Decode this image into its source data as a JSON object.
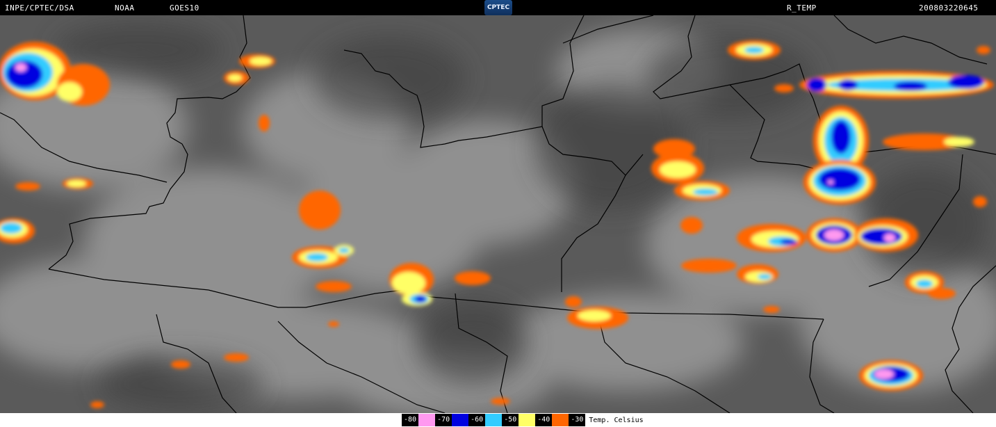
{
  "header": {
    "source": "INPE/CPTEC/DSA",
    "agency": "NOAA",
    "satellite": "GOES10",
    "logo_text": "CPTEC",
    "product": "R_TEMP",
    "timestamp": "200803220645"
  },
  "legend": {
    "entries": [
      {
        "label": "-80",
        "color": "#ff99f0"
      },
      {
        "label": "-70",
        "color": "#0000e0"
      },
      {
        "label": "-60",
        "color": "#33ccff"
      },
      {
        "label": "-50",
        "color": "#ffff66"
      },
      {
        "label": "-40",
        "color": "#ff6600"
      },
      {
        "label": "-30",
        "color": ""
      }
    ],
    "units": "Temp. Celsius"
  },
  "map": {
    "background_color": "#5a5a5a",
    "cloud_color": "#bdbdbd",
    "border_color": "#000000"
  }
}
